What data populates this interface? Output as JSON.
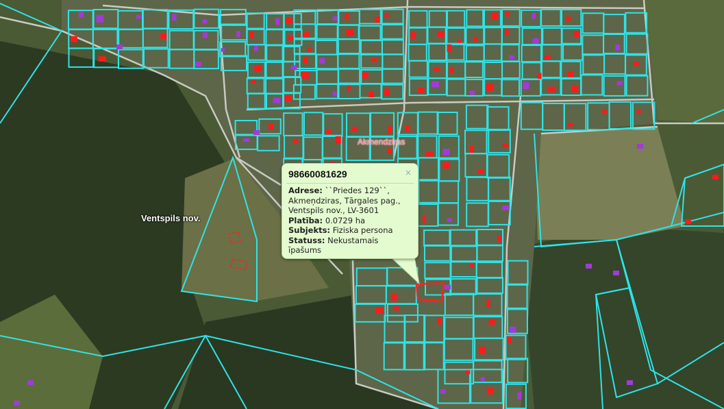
{
  "map": {
    "labels": {
      "county": "Ventspils nov.",
      "village": "Akmendziras"
    },
    "colors": {
      "parcel_border": "#2fe3e8",
      "road": "#c9cbc4",
      "building_red": "#ff1a1a",
      "building_purple": "#a23ad8",
      "selected_parcel": "#ff2020"
    }
  },
  "popup": {
    "parcel_id": "98660081629",
    "close_label": "×",
    "rows": [
      {
        "key": "Adrese:",
        "value": "``Priedes 129``, Akmeņdziras, Tārgales pag., Ventspils nov., LV-3601"
      },
      {
        "key": "Platība:",
        "value": "0.0729 ha"
      },
      {
        "key": "Subjekts:",
        "value": "Fiziska persona"
      },
      {
        "key": "Statuss:",
        "value": "Nekustamais īpašums"
      }
    ]
  }
}
